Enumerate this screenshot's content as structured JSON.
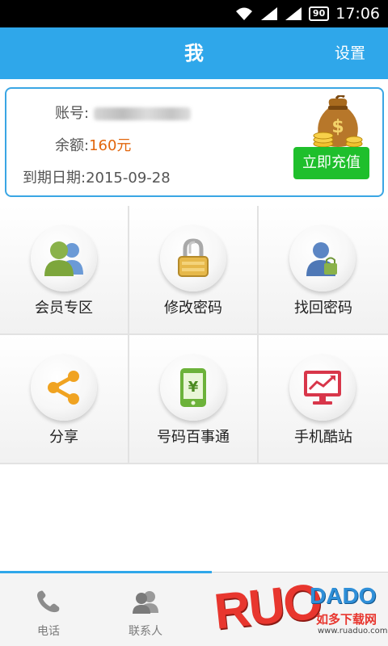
{
  "status_bar": {
    "time": "17:06",
    "battery": "90",
    "icons": [
      "wifi-icon",
      "signal-icon",
      "signal-icon",
      "battery-icon"
    ]
  },
  "header": {
    "title": "我",
    "settings_label": "设置",
    "color": "#2fa7ea"
  },
  "account": {
    "account_label": "账号:",
    "balance_label": "余额:",
    "balance_value": "160元",
    "expire_label": "到期日期:",
    "expire_value": "2015-09-28",
    "recharge_label": "立即充值",
    "balance_color": "#e2660c",
    "recharge_color": "#1fbf2c"
  },
  "grid": {
    "items": [
      {
        "label": "会员专区",
        "icon": "members-icon"
      },
      {
        "label": "修改密码",
        "icon": "lock-icon"
      },
      {
        "label": "找回密码",
        "icon": "user-key-icon"
      },
      {
        "label": "分享",
        "icon": "share-icon"
      },
      {
        "label": "号码百事通",
        "icon": "phone-yen-icon"
      },
      {
        "label": "手机酷站",
        "icon": "monitor-chart-icon"
      }
    ]
  },
  "tab_bar": {
    "tabs": [
      {
        "label": "电话",
        "icon": "phone-icon"
      },
      {
        "label": "联系人",
        "icon": "contacts-icon"
      }
    ]
  },
  "watermark": {
    "brand_left": "RUO",
    "brand_right": "DADO",
    "cn_text": "如多下载网",
    "url": "www.ruaduo.com"
  }
}
